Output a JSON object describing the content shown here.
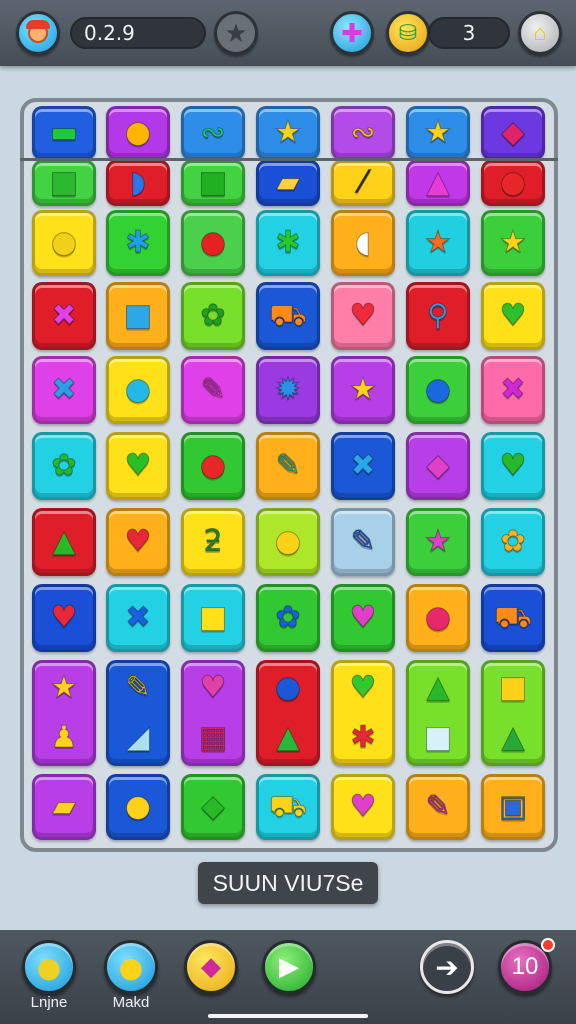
{
  "header": {
    "left_value": "0.2.9",
    "currency_value": "3",
    "avatar_icon": "player-avatar-icon",
    "star_icon": "star-icon",
    "puzzle_icon": "puzzle-icon",
    "coin_icon": "coin-bag-icon",
    "shop_icon": "shop-cart-icon"
  },
  "board": {
    "rows": [
      [
        {
          "glyph": "▬",
          "color": "#1ec93a",
          "bg": "#1f5fe0"
        },
        {
          "glyph": "●",
          "color": "#ffb400",
          "bg": "#b238e8"
        },
        {
          "glyph": "∾",
          "color": "#20d070",
          "bg": "#2e8de8"
        },
        {
          "glyph": "★",
          "color": "#ffd21a",
          "bg": "#2e8de8"
        },
        {
          "glyph": "∾",
          "color": "#ffc21a",
          "bg": "#b24be8"
        },
        {
          "glyph": "★",
          "color": "#ffd21a",
          "bg": "#2e8de8"
        },
        {
          "glyph": "◆",
          "color": "#e0246a",
          "bg": "#6c38e0"
        }
      ],
      [
        {
          "glyph": "■",
          "color": "#2cb82c",
          "bg": "#42d242"
        },
        {
          "glyph": "◗",
          "color": "#2a78e8",
          "bg": "#e01e2a"
        },
        {
          "glyph": "■",
          "color": "#20b020",
          "bg": "#42d242"
        },
        {
          "glyph": "▰",
          "color": "#ffd23a",
          "bg": "#1a4fd8"
        },
        {
          "glyph": "⁄",
          "color": "#2a2a2a",
          "bg": "#ffd21a"
        },
        {
          "glyph": "▲",
          "color": "#e83ad8",
          "bg": "#c038e8"
        },
        {
          "glyph": "●",
          "color": "#e82828",
          "bg": "#e01e2a"
        }
      ],
      [
        {
          "glyph": "●",
          "color": "#f0d018",
          "bg": "#ffe11a"
        },
        {
          "glyph": "✱",
          "color": "#1f9fe8",
          "bg": "#32d232"
        },
        {
          "glyph": "●",
          "color": "#e42222",
          "bg": "#4ad04a"
        },
        {
          "glyph": "✱",
          "color": "#28c82c",
          "bg": "#22d2e4"
        },
        {
          "glyph": "◖",
          "color": "#ffffff",
          "bg": "#ffb01a"
        },
        {
          "glyph": "★",
          "color": "#ff6a1a",
          "bg": "#20d0e0"
        },
        {
          "glyph": "★",
          "color": "#ffd21a",
          "bg": "#3ccf3c"
        }
      ],
      [
        {
          "glyph": "✖",
          "color": "#e040e8",
          "bg": "#e01e2a"
        },
        {
          "glyph": "■",
          "color": "#2aa8e8",
          "bg": "#ffb01a"
        },
        {
          "glyph": "✿",
          "color": "#20a020",
          "bg": "#78e02a"
        },
        {
          "glyph": "⛟",
          "color": "#ff8a1a",
          "bg": "#1a58d8"
        },
        {
          "glyph": "♥",
          "color": "#f02a3a",
          "bg": "#ff7fa8"
        },
        {
          "glyph": "⚲",
          "color": "#28a0e8",
          "bg": "#e01e2a"
        },
        {
          "glyph": "♥",
          "color": "#2cc02c",
          "bg": "#ffe11a"
        }
      ],
      [
        {
          "glyph": "✖",
          "color": "#2aa0e8",
          "bg": "#e040e8"
        },
        {
          "glyph": "●",
          "color": "#22b8e8",
          "bg": "#ffe11a"
        },
        {
          "glyph": "✎",
          "color": "#e040c8",
          "bg": "#e040e8"
        },
        {
          "glyph": "✹",
          "color": "#2a90e8",
          "bg": "#9a3ae0"
        },
        {
          "glyph": "★",
          "color": "#ffd21a",
          "bg": "#b83ee8"
        },
        {
          "glyph": "●",
          "color": "#1a68e0",
          "bg": "#3ccf3c"
        },
        {
          "glyph": "✖",
          "color": "#d028d8",
          "bg": "#ff6aa8"
        }
      ],
      [
        {
          "glyph": "✿",
          "color": "#24b82c",
          "bg": "#22d2e4"
        },
        {
          "glyph": "♥",
          "color": "#28c028",
          "bg": "#ffe11a"
        },
        {
          "glyph": "●",
          "color": "#e42828",
          "bg": "#32c832"
        },
        {
          "glyph": "✎",
          "color": "#28c0a8",
          "bg": "#ffb01a"
        },
        {
          "glyph": "✖",
          "color": "#28a8e8",
          "bg": "#1a58d8"
        },
        {
          "glyph": "◆",
          "color": "#e040c8",
          "bg": "#b83ee8"
        },
        {
          "glyph": "♥",
          "color": "#28b828",
          "bg": "#22d2e4"
        }
      ],
      [
        {
          "glyph": "▲",
          "color": "#28b828",
          "bg": "#e01e2a"
        },
        {
          "glyph": "♥",
          "color": "#e82838",
          "bg": "#ffb01a"
        },
        {
          "glyph": "ƻ",
          "color": "#1a8a2a",
          "bg": "#ffe11a"
        },
        {
          "glyph": "●",
          "color": "#ffd21a",
          "bg": "#aee62a"
        },
        {
          "glyph": "✎",
          "color": "#2a5ad8",
          "bg": "#a8d0e8"
        },
        {
          "glyph": "★",
          "color": "#e040c8",
          "bg": "#3ccf3c"
        },
        {
          "glyph": "✿",
          "color": "#ffb01a",
          "bg": "#22d2e4"
        }
      ],
      [
        {
          "glyph": "♥",
          "color": "#e82838",
          "bg": "#1a4fd8"
        },
        {
          "glyph": "✖",
          "color": "#1a60e0",
          "bg": "#22d2e4"
        },
        {
          "glyph": "■",
          "color": "#ffe11a",
          "bg": "#22d2e4"
        },
        {
          "glyph": "✿",
          "color": "#1a60e0",
          "bg": "#32c832"
        },
        {
          "glyph": "♥",
          "color": "#e040c8",
          "bg": "#32c832"
        },
        {
          "glyph": "●",
          "color": "#e8286a",
          "bg": "#ffb01a"
        },
        {
          "glyph": "⛟",
          "color": "#ff8a1a",
          "bg": "#1a4fd8"
        }
      ],
      [
        {
          "glyph": "★",
          "color": "#ffd21a",
          "bg": "#b83ee8",
          "glyph2": "♟",
          "color2": "#ffd21a"
        },
        {
          "glyph": "✎",
          "color": "#ffd21a",
          "bg": "#1a58d8",
          "glyph2": "◢",
          "color2": "#a8e0f0"
        },
        {
          "glyph": "♥",
          "color": "#e040a8",
          "bg": "#b83ee8",
          "glyph2": "▦",
          "color2": "#e02a58"
        },
        {
          "glyph": "●",
          "color": "#1a58d8",
          "bg": "#e01e2a",
          "glyph2": "▲",
          "color2": "#28b83c"
        },
        {
          "glyph": "♥",
          "color": "#32c832",
          "bg": "#ffe11a",
          "glyph2": "✱",
          "color2": "#e82838"
        },
        {
          "glyph": "▲",
          "color": "#28b828",
          "bg": "#78e02a",
          "glyph2": "■",
          "color2": "#d8f0f8"
        },
        {
          "glyph": "■",
          "color": "#ffd21a",
          "bg": "#78e02a",
          "glyph2": "▲",
          "color2": "#28a838"
        }
      ],
      [
        {
          "glyph": "▰",
          "color": "#ffd21a",
          "bg": "#b83ee8"
        },
        {
          "glyph": "●",
          "color": "#ffd21a",
          "bg": "#1a58d8"
        },
        {
          "glyph": "◆",
          "color": "#28b828",
          "bg": "#32c832"
        },
        {
          "glyph": "⛟",
          "color": "#ffd21a",
          "bg": "#22d2e4"
        },
        {
          "glyph": "♥",
          "color": "#e040c8",
          "bg": "#ffe11a"
        },
        {
          "glyph": "✎",
          "color": "#d028c8",
          "bg": "#ffb01a"
        },
        {
          "glyph": "▣",
          "color": "#2a6ad8",
          "bg": "#ffb01a"
        }
      ]
    ]
  },
  "banner": {
    "text": "SUUN VIU7Se"
  },
  "footer": {
    "buttons": [
      {
        "label": "Lnjne",
        "icon": "lime-fruit-icon"
      },
      {
        "label": "Makd",
        "icon": "yellow-bell-icon"
      },
      {
        "label": "",
        "icon": "gift-box-icon"
      },
      {
        "label": "",
        "icon": "play-flag-icon"
      },
      {
        "label": "",
        "icon": "arrow-right-icon"
      },
      {
        "label": "",
        "value": "10",
        "icon": "moves-counter-icon"
      }
    ]
  }
}
